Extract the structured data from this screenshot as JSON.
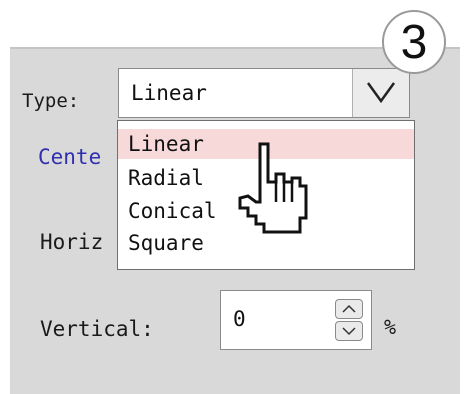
{
  "step_badge": "3",
  "type_field": {
    "label": "Type:",
    "value": "Linear"
  },
  "type_options": [
    "Linear",
    "Radial",
    "Conical",
    "Square"
  ],
  "highlighted_option": "Linear",
  "center_label": "Cente",
  "horizontal_label": "Horiz",
  "vertical_field": {
    "label": "Vertical:",
    "value": "0",
    "unit": "%"
  },
  "icons": {
    "dropdown": "chevron-down-icon",
    "spin_up": "chevron-up-icon",
    "spin_down": "chevron-down-icon",
    "cursor": "hand-pointer-icon"
  },
  "colors": {
    "panel": "#d9d9d9",
    "highlight": "#f7d9d9",
    "link_label": "#2f2fb0"
  }
}
